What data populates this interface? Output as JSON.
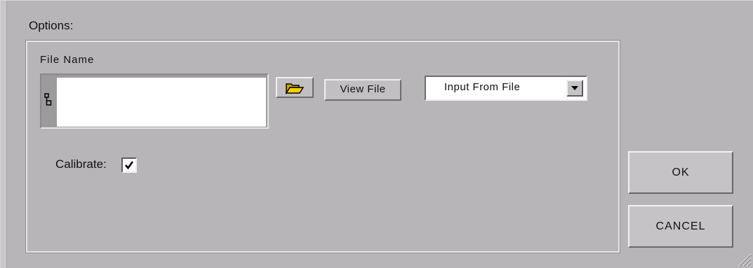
{
  "options": {
    "title": "Options:",
    "file_name_label": "File Name",
    "file_name_value": "",
    "view_file_label": "View File",
    "source_select": {
      "selected": "Input From File"
    },
    "calibrate_label": "Calibrate:",
    "calibrate_checked": true
  },
  "actions": {
    "ok_label": "OK",
    "cancel_label": "CANCEL"
  },
  "icons": {
    "browse": "folder-open-icon",
    "path": "path-icon",
    "dropdown": "chevron-down-icon",
    "check": "check-icon",
    "grip": "resize-grip-icon"
  }
}
